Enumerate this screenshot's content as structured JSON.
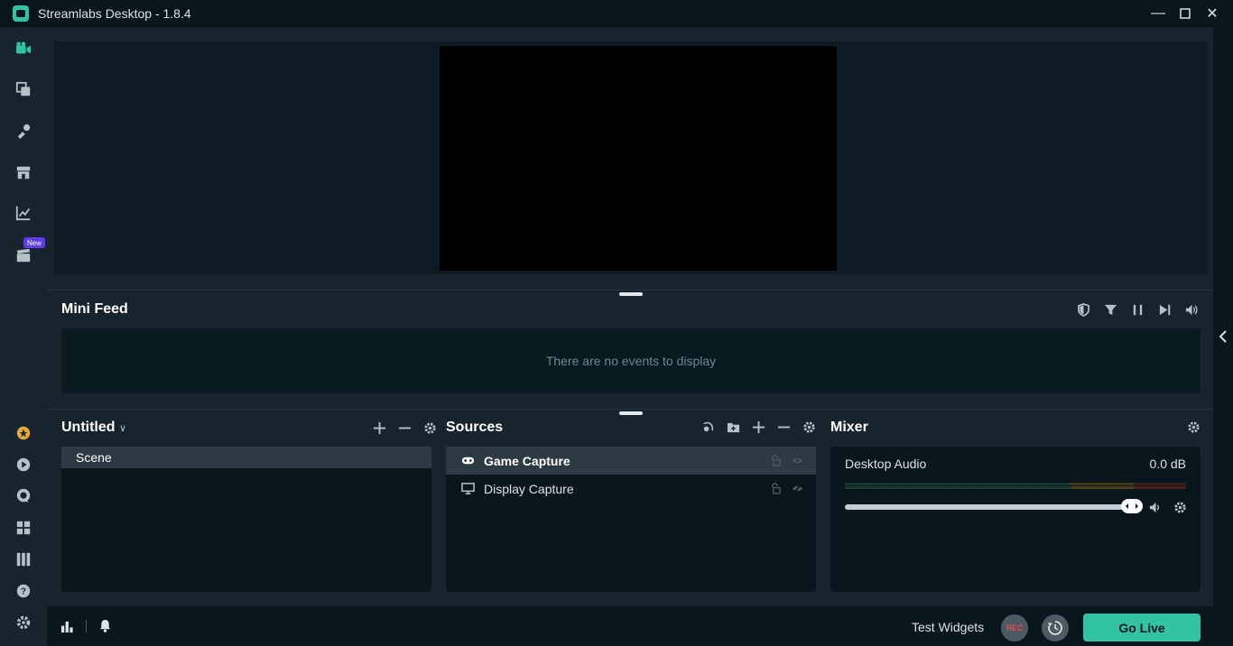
{
  "window": {
    "title": "Streamlabs Desktop - 1.8.4"
  },
  "sidebar": {
    "new_badge": "New",
    "top_icons": [
      "camera-icon",
      "layers-icon",
      "themes-icon",
      "store-icon",
      "analytics-icon",
      "clapper-icon"
    ],
    "bottom_icons": [
      "prime-icon",
      "cloudbot-icon",
      "chat-icon",
      "grid-icon",
      "layout-icon",
      "help-icon",
      "settings-icon"
    ]
  },
  "minifeed": {
    "title": "Mini Feed",
    "empty_text": "There are no events to display"
  },
  "scenes": {
    "title": "Untitled",
    "items": [
      "Scene"
    ]
  },
  "sources": {
    "title": "Sources",
    "items": [
      {
        "label": "Game Capture",
        "icon": "gamepad-icon",
        "selected": true
      },
      {
        "label": "Display Capture",
        "icon": "monitor-icon",
        "selected": false
      }
    ]
  },
  "mixer": {
    "title": "Mixer",
    "channel": {
      "name": "Desktop Audio",
      "level": "0.0 dB",
      "volume": 0.97
    }
  },
  "footer": {
    "test_widgets": "Test Widgets",
    "rec_label": "REC",
    "go_live": "Go Live"
  },
  "colors": {
    "accent": "#31c3a2",
    "bg": "#17242d",
    "dark": "#09161d"
  }
}
